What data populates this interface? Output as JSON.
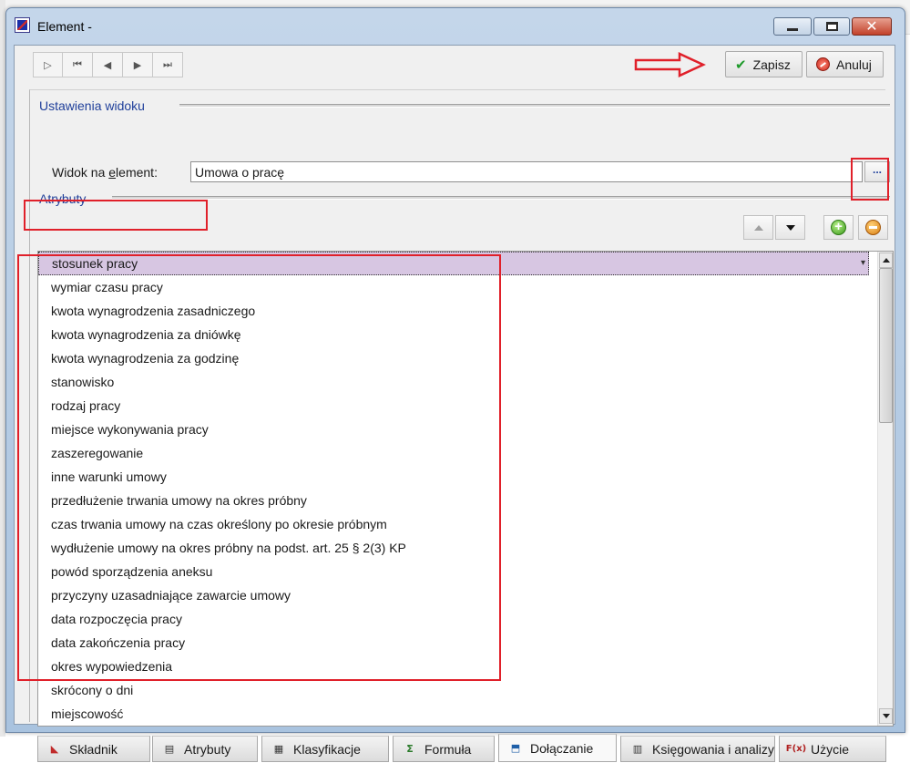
{
  "window": {
    "title": "Element -",
    "controls": {
      "minimize": "minimize",
      "maximize": "maximize",
      "close": "✕"
    }
  },
  "toolbar": {
    "nav": [
      "▷",
      "⏮",
      "◀",
      "▶",
      "⏭"
    ],
    "save_label": "Zapisz",
    "cancel_label": "Anuluj"
  },
  "view_settings": {
    "section_title": "Ustawienia widoku",
    "field_label": "Widok na element:",
    "field_value": "Umowa o pracę",
    "browse_label": "..."
  },
  "attributes": {
    "section_title": "Atrybuty",
    "items": [
      "stosunek pracy",
      "wymiar czasu pracy",
      "kwota wynagrodzenia zasadniczego",
      "kwota wynagrodzenia za dniówkę",
      "kwota wynagrodzenia za godzinę",
      "stanowisko",
      "rodzaj pracy",
      "miejsce wykonywania pracy",
      "zaszeregowanie",
      "inne warunki umowy",
      "przedłużenie trwania umowy na okres próbny",
      "czas trwania umowy na czas określony po okresie próbnym",
      "wydłużenie umowy na okres próbny na podst. art. 25 § 2(3) KP",
      "powód sporządzenia aneksu",
      "przyczyny uzasadniające zawarcie umowy",
      "data rozpoczęcia pracy",
      "data zakończenia pracy",
      "okres wypowiedzenia",
      "skrócony o dni",
      "miejscowość"
    ],
    "selected_index": 0
  },
  "tabs": [
    {
      "label": "Składnik",
      "icon": "skladnik-icon"
    },
    {
      "label": "Atrybuty",
      "icon": "atrybuty-icon"
    },
    {
      "label": "Klasyfikacje",
      "icon": "klasyfikacje-icon"
    },
    {
      "label": "Formuła",
      "icon": "formula-icon"
    },
    {
      "label": "Dołączanie",
      "icon": "dolaczanie-icon"
    },
    {
      "label": "Księgowania i analizy",
      "icon": "ksiegowania-icon"
    },
    {
      "label": "Użycie",
      "icon": "uzycie-icon"
    }
  ],
  "active_tab": "Dołączanie",
  "colors": {
    "annotation_red": "#e0202a",
    "selected_row": "#d7c6e2",
    "section_title": "#1f3f9a"
  }
}
